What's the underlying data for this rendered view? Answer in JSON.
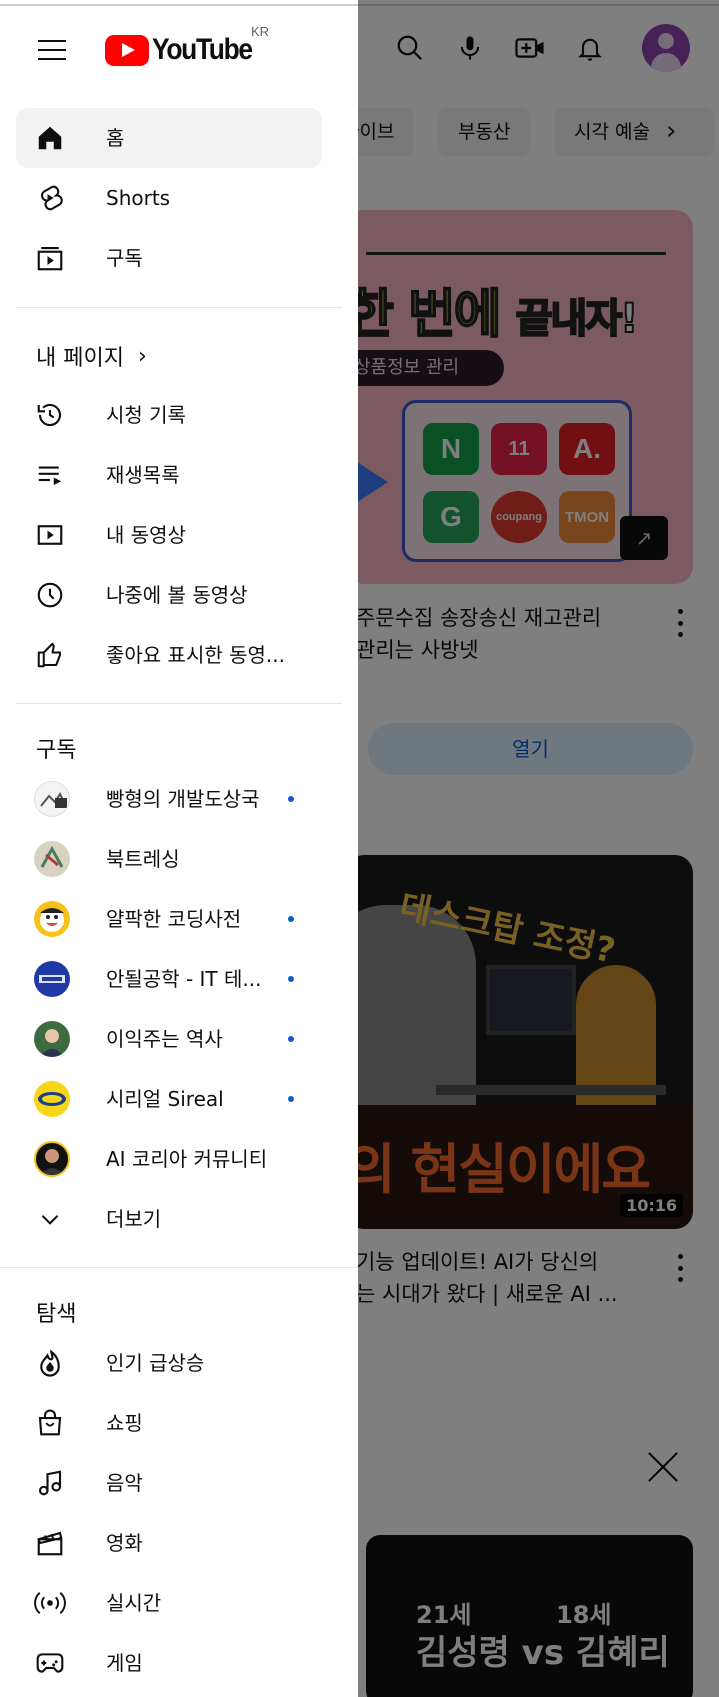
{
  "header": {
    "logo_text": "YouTube",
    "region": "KR",
    "icons": [
      "menu-icon",
      "search-icon",
      "mic-icon",
      "create-icon",
      "bell-icon",
      "avatar"
    ]
  },
  "chips": [
    "라이브",
    "부동산",
    "시각 예술"
  ],
  "feed": {
    "ad": {
      "headline": "한 번에",
      "headline_small": "끝내자!",
      "pill": "상품정보 관리",
      "marketplaces": [
        "N",
        "11",
        "A.",
        "G",
        "coupang",
        "TMON"
      ],
      "title_line1": "주문수집 송장송신 재고관리",
      "title_line2": "관리는 사방넷",
      "open_label": "열기"
    },
    "video1": {
      "overlay_question": "데스크탑 조정?",
      "overlay_big": "의 현실이에요",
      "duration": "10:16",
      "title_line1": "기능 업데이트! AI가 당신의",
      "title_line2": "는 시대가 왔다 | 새로운 AI ..."
    },
    "video2": {
      "age_a": "21세",
      "age_b": "18세",
      "names": "김성령 vs 김혜리"
    }
  },
  "drawer": {
    "main": [
      {
        "label": "홈",
        "icon": "home-icon"
      },
      {
        "label": "Shorts",
        "icon": "shorts-icon"
      },
      {
        "label": "구독",
        "icon": "subscriptions-icon"
      }
    ],
    "you_header": "내 페이지",
    "you": [
      {
        "label": "시청 기록",
        "icon": "history-icon"
      },
      {
        "label": "재생목록",
        "icon": "playlist-icon"
      },
      {
        "label": "내 동영상",
        "icon": "your-videos-icon"
      },
      {
        "label": "나중에 볼 동영상",
        "icon": "watch-later-icon"
      },
      {
        "label": "좋아요 표시한 동영...",
        "icon": "liked-icon"
      }
    ],
    "subs_header": "구독",
    "subscriptions": [
      {
        "label": "빵형의 개발도상국",
        "dot": true
      },
      {
        "label": "북트레싱",
        "dot": false
      },
      {
        "label": "얄팍한 코딩사전",
        "dot": true
      },
      {
        "label": "안될공학 - IT 테...",
        "dot": true
      },
      {
        "label": "이익주는 역사",
        "dot": true
      },
      {
        "label": "시리얼 Sireal",
        "dot": true
      },
      {
        "label": "AI 코리아 커뮤니티",
        "dot": false
      }
    ],
    "more_label": "더보기",
    "explore_header": "탐색",
    "explore": [
      {
        "label": "인기 급상승",
        "icon": "trending-icon"
      },
      {
        "label": "쇼핑",
        "icon": "shopping-icon"
      },
      {
        "label": "음악",
        "icon": "music-icon"
      },
      {
        "label": "영화",
        "icon": "movies-icon"
      },
      {
        "label": "실시간",
        "icon": "live-icon"
      },
      {
        "label": "게임",
        "icon": "gaming-icon"
      }
    ]
  },
  "colors": {
    "brand_red": "#ff0000",
    "accent_blue": "#065fd4",
    "avatar_purple": "#8e44ad"
  }
}
